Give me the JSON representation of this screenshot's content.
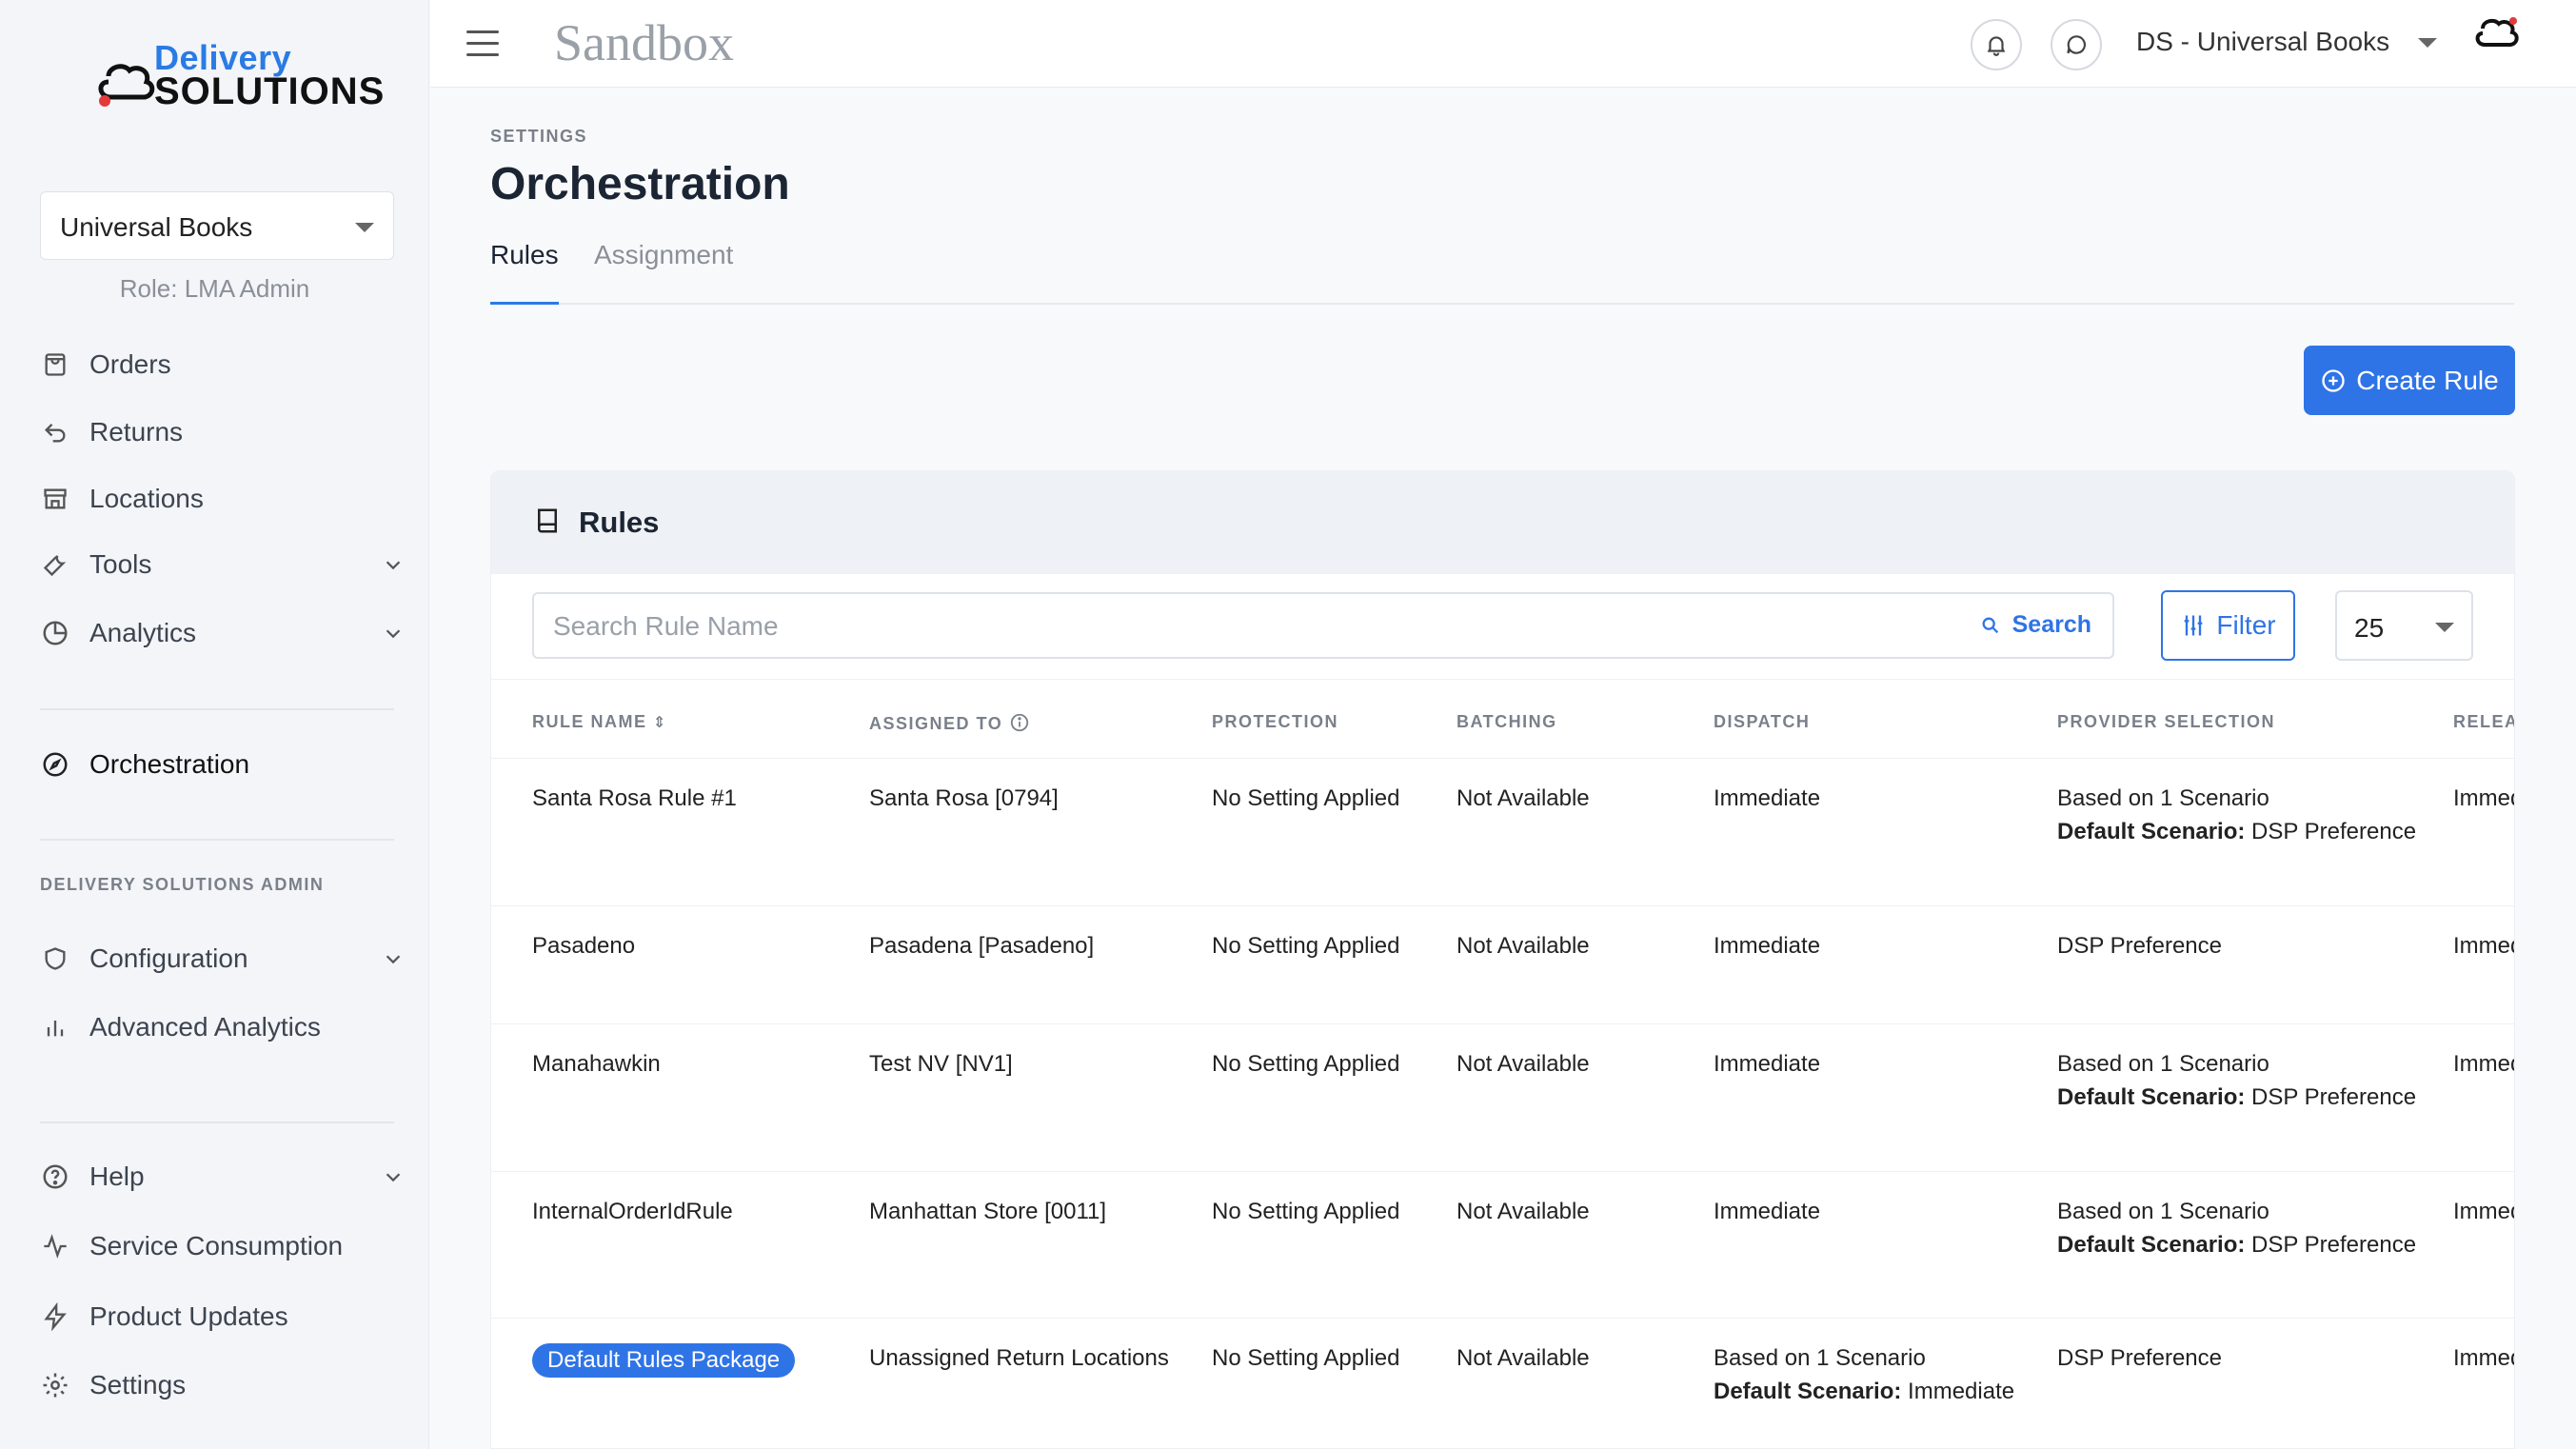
{
  "brand": {
    "line1": "Delivery",
    "line2": "SOLUTIONS"
  },
  "sidebar": {
    "company": "Universal Books",
    "role": "Role: LMA Admin",
    "items": [
      {
        "label": "Orders"
      },
      {
        "label": "Returns"
      },
      {
        "label": "Locations"
      },
      {
        "label": "Tools"
      },
      {
        "label": "Analytics"
      },
      {
        "label": "Orchestration"
      }
    ],
    "admin_section": "DELIVERY SOLUTIONS ADMIN",
    "admin_items": [
      {
        "label": "Configuration"
      },
      {
        "label": "Advanced Analytics"
      }
    ],
    "footer_items": [
      {
        "label": "Help"
      },
      {
        "label": "Service Consumption"
      },
      {
        "label": "Product Updates"
      },
      {
        "label": "Settings"
      }
    ]
  },
  "header": {
    "environment": "Sandbox",
    "org": "DS - Universal Books"
  },
  "page": {
    "breadcrumb": "SETTINGS",
    "title": "Orchestration",
    "tabs": [
      "Rules",
      "Assignment"
    ],
    "create_button": "Create Rule"
  },
  "card": {
    "title": "Rules",
    "search_placeholder": "Search Rule Name",
    "search_button": "Search",
    "filter_button": "Filter",
    "page_size": "25"
  },
  "table": {
    "headers": [
      "RULE NAME",
      "ASSIGNED TO",
      "PROTECTION",
      "BATCHING",
      "DISPATCH",
      "PROVIDER SELECTION",
      "RELEAS"
    ],
    "rows": [
      {
        "name": "Santa Rosa Rule #1",
        "assigned": "Santa Rosa [0794]",
        "protection": "No Setting Applied",
        "batching": "Not Available",
        "dispatch1": "Immediate",
        "dispatch2_bold": "",
        "dispatch2": "",
        "provider1": "Based on 1 Scenario",
        "provider2_bold": "Default Scenario:",
        "provider2": " DSP Preference",
        "release": "Immediate"
      },
      {
        "name": "Pasadeno",
        "assigned": "Pasadena [Pasadeno]",
        "protection": "No Setting Applied",
        "batching": "Not Available",
        "dispatch1": "Immediate",
        "dispatch2_bold": "",
        "dispatch2": "",
        "provider1": "DSP Preference",
        "provider2_bold": "",
        "provider2": "",
        "release": "Immediate"
      },
      {
        "name": "Manahawkin",
        "assigned": "Test NV [NV1]",
        "protection": "No Setting Applied",
        "batching": "Not Available",
        "dispatch1": "Immediate",
        "dispatch2_bold": "",
        "dispatch2": "",
        "provider1": "Based on 1 Scenario",
        "provider2_bold": "Default Scenario:",
        "provider2": " DSP Preference",
        "release": "Immediate"
      },
      {
        "name": "InternalOrderIdRule",
        "assigned": "Manhattan Store [0011]",
        "protection": "No Setting Applied",
        "batching": "Not Available",
        "dispatch1": "Immediate",
        "dispatch2_bold": "",
        "dispatch2": "",
        "provider1": "Based on 1 Scenario",
        "provider2_bold": "Default Scenario:",
        "provider2": " DSP Preference",
        "release": "Immediate"
      },
      {
        "name": "Default Rules Package",
        "assigned": "Unassigned Return Locations",
        "protection": "No Setting Applied",
        "batching": "Not Available",
        "dispatch1": "Based on 1 Scenario",
        "dispatch2_bold": "Default Scenario:",
        "dispatch2": " Immediate",
        "provider1": "DSP Preference",
        "provider2_bold": "",
        "provider2": "",
        "release": "Immediate"
      }
    ]
  },
  "colors": {
    "accent": "#2f74e6",
    "sidebar_bg": "#f3f5f8"
  }
}
